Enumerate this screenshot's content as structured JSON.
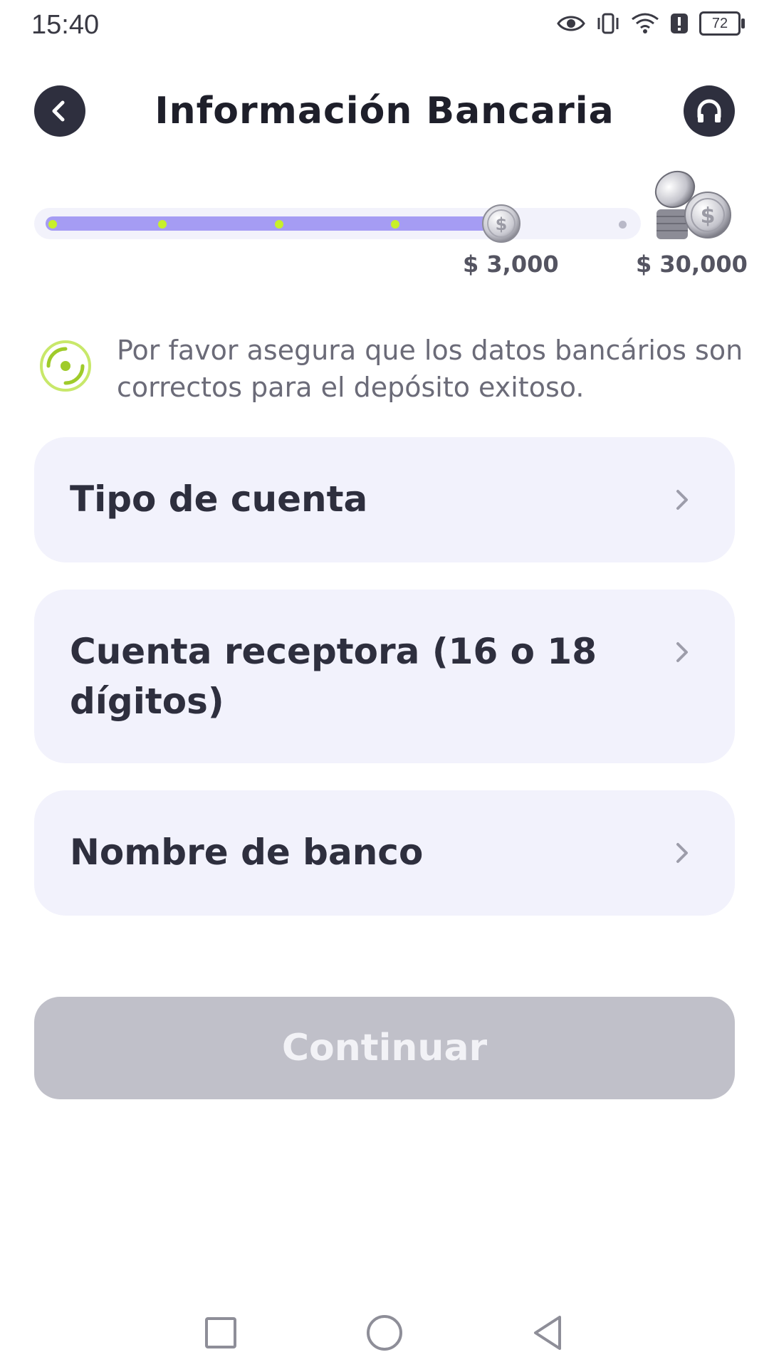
{
  "status_bar": {
    "time": "15:40",
    "battery": "72",
    "icons": [
      "eye-icon",
      "vibrate-icon",
      "wifi-icon",
      "alert-icon",
      "battery-icon"
    ]
  },
  "header": {
    "title": "Información Bancaria",
    "back_icon": "chevron-left-icon",
    "support_icon": "headset-icon"
  },
  "progress": {
    "fraction": 0.78,
    "current_amount": "$ 3,000",
    "max_amount": "$ 30,000",
    "fill_color": "#a59cf3",
    "dot_color": "#c8f02a"
  },
  "notice": {
    "text": "Por favor asegura que los datos bancários son correctos para el depósito exitoso."
  },
  "fields": [
    {
      "label": "Tipo de cuenta"
    },
    {
      "label": "Cuenta receptora (16 o 18 dígitos)"
    },
    {
      "label": "Nombre de banco"
    }
  ],
  "continue_button": {
    "label": "Continuar",
    "enabled": false
  },
  "nav_bar": {
    "buttons": [
      "recents-square-icon",
      "home-circle-icon",
      "back-triangle-icon"
    ]
  }
}
